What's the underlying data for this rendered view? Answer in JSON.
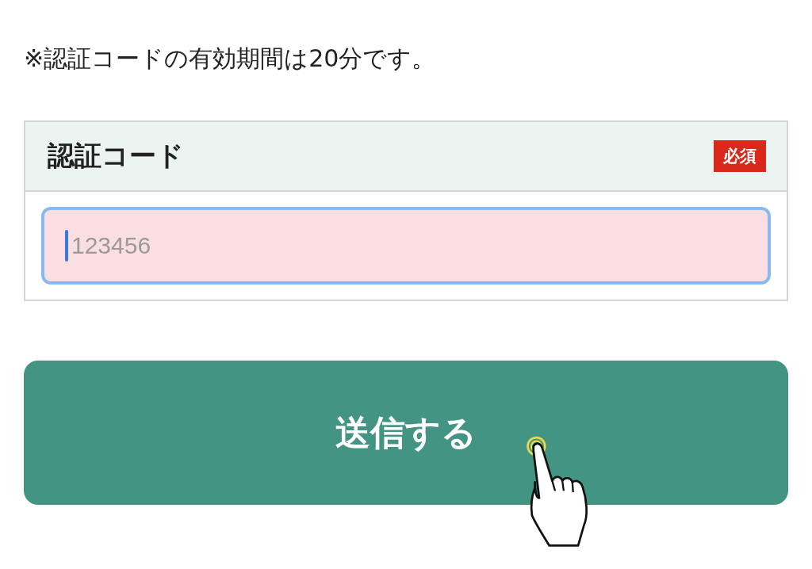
{
  "note": "※認証コードの有効期間は20分です。",
  "form": {
    "label": "認証コード",
    "badge": "必須",
    "field": {
      "placeholder": "123456",
      "focused": true
    }
  },
  "submit_button": {
    "label": "送信する"
  }
}
